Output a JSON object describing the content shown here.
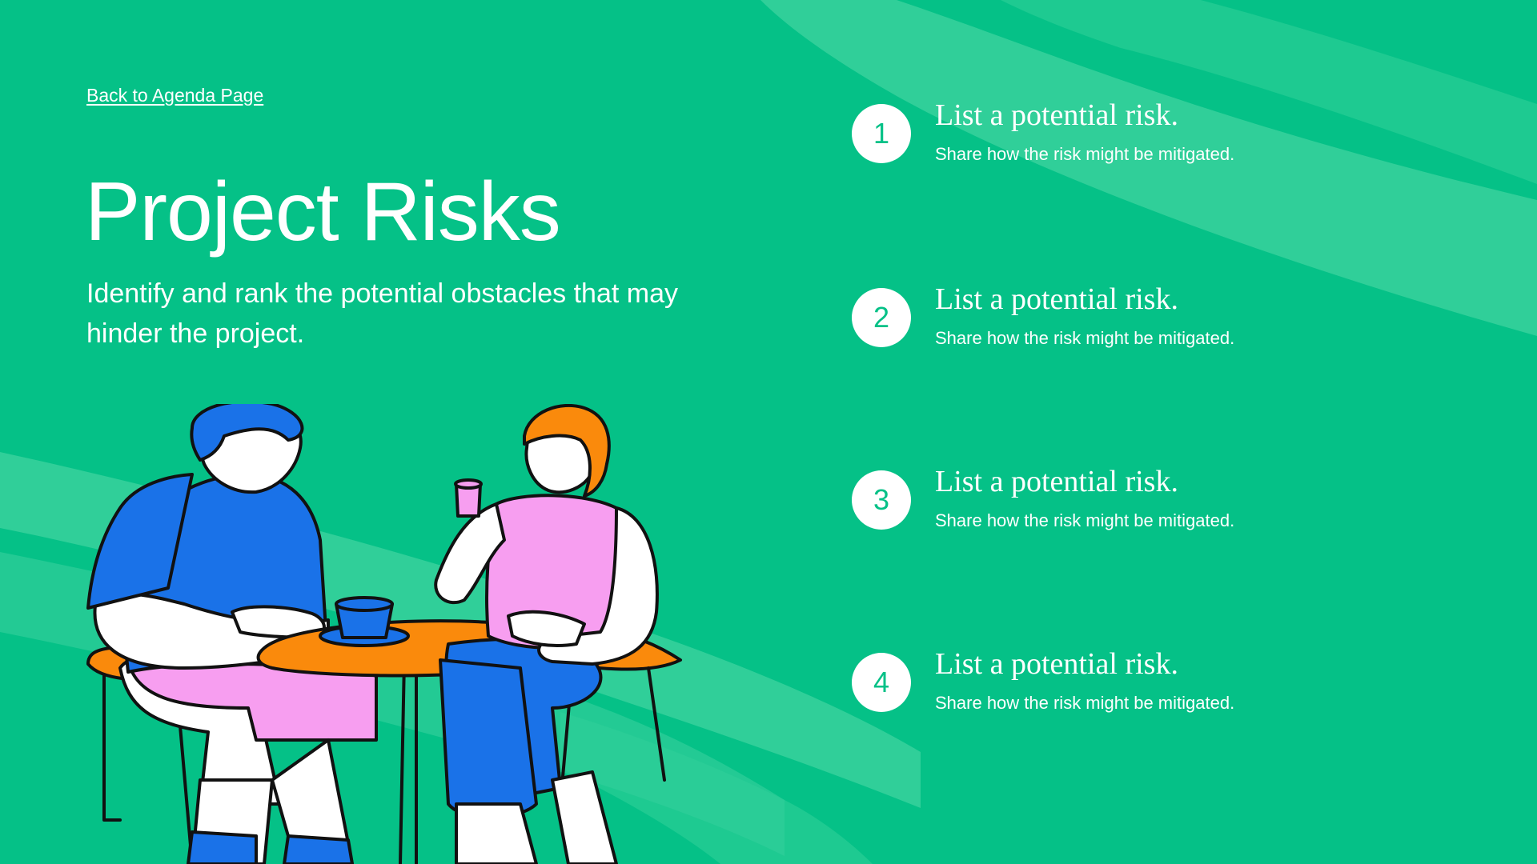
{
  "nav": {
    "back_link": "Back to Agenda Page"
  },
  "header": {
    "title": "Project Risks",
    "subtitle": "Identify and rank the potential obstacles that may hinder the project."
  },
  "risks": [
    {
      "number": "1",
      "title": "List a potential risk.",
      "description": "Share how the risk might be mitigated."
    },
    {
      "number": "2",
      "title": "List a potential risk.",
      "description": "Share how the risk might be mitigated."
    },
    {
      "number": "3",
      "title": "List a potential risk.",
      "description": "Share how the risk might be mitigated."
    },
    {
      "number": "4",
      "title": "List a potential risk.",
      "description": "Share how the risk might be mitigated."
    }
  ],
  "illustration": {
    "icon": "two-people-at-cafe-table-illustration"
  },
  "colors": {
    "background": "#05c187",
    "brush_strokes": "#3fd39f",
    "text": "#ffffff",
    "blue": "#1a72e8",
    "pink": "#f79ef0",
    "orange": "#fa8a0c"
  }
}
